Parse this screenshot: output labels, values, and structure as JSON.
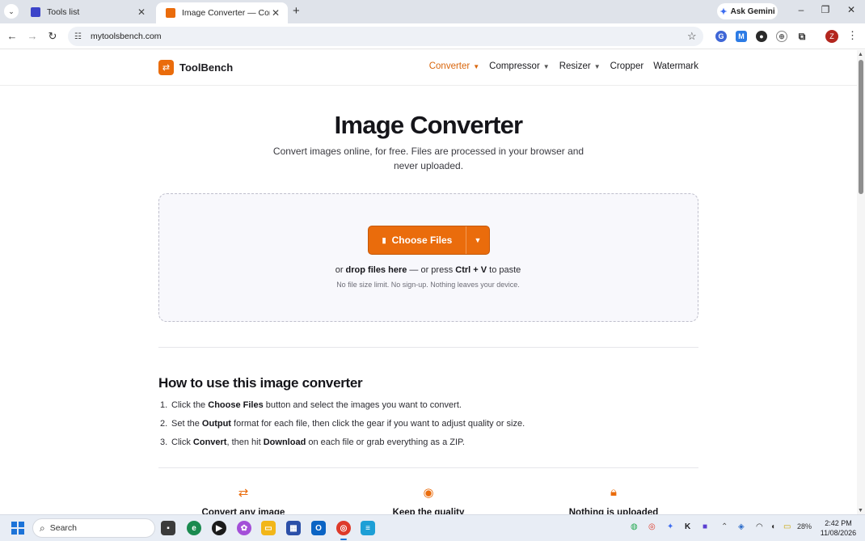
{
  "browser": {
    "tabs": [
      {
        "title": "Tools list",
        "favicon_color": "#3c44c9",
        "active": false
      },
      {
        "title": "Image Converter — Convert JPG",
        "favicon_color": "#ea6c0c",
        "active": true
      }
    ],
    "ask_gemini": "Ask Gemini",
    "url": "mytoolsbench.com",
    "profile_initial": "Z"
  },
  "site": {
    "brand": "ToolBench",
    "nav": [
      {
        "label": "Converter",
        "dropdown": true,
        "active": true
      },
      {
        "label": "Compressor",
        "dropdown": true,
        "active": false
      },
      {
        "label": "Resizer",
        "dropdown": true,
        "active": false
      },
      {
        "label": "Cropper",
        "dropdown": false,
        "active": false
      },
      {
        "label": "Watermark",
        "dropdown": false,
        "active": false
      }
    ],
    "accent_color": "#ea6c0c"
  },
  "hero": {
    "title": "Image Converter",
    "subtitle": "Convert images online, for free. Files are processed in your browser and never uploaded."
  },
  "dropzone": {
    "button_label": "Choose Files",
    "drop_prefix": "or",
    "drop_bold": "drop files here",
    "drop_middle": "— or press",
    "drop_shortcut": "Ctrl + V",
    "drop_suffix": "to paste",
    "note": "No file size limit. No sign-up. Nothing leaves your device."
  },
  "howto": {
    "title": "How to use this image converter",
    "steps": [
      {
        "num": "1.",
        "pre": "Click the",
        "bold": "Choose Files",
        "post": "button and select the images you want to convert."
      },
      {
        "num": "2.",
        "pre": "Set the",
        "bold": "Output",
        "post": "format for each file, then click the gear if you want to adjust quality or size."
      },
      {
        "num": "3.",
        "pre": "Click",
        "bold": "Convert",
        "mid": ", then hit",
        "bold2": "Download",
        "post": "on each file or grab everything as a ZIP."
      }
    ]
  },
  "features": [
    {
      "icon": "swap-arrows-icon",
      "label": "Convert any image"
    },
    {
      "icon": "target-icon",
      "label": "Keep the quality"
    },
    {
      "icon": "lock-icon",
      "label": "Nothing is uploaded"
    }
  ],
  "taskbar": {
    "search_placeholder": "Search",
    "battery": "28%",
    "time": "2:42 PM",
    "date": "11/08/2026"
  }
}
